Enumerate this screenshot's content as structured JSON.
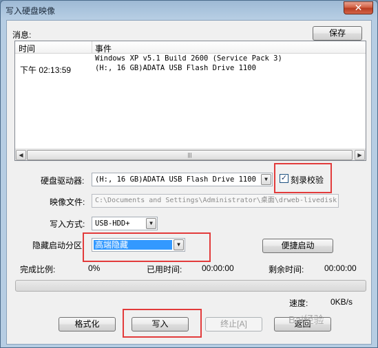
{
  "window": {
    "title": "写入硬盘映像",
    "close_glyph": "✕"
  },
  "messages": {
    "label": "消息:",
    "save_button": "保存",
    "columns": [
      "时间",
      "事件"
    ],
    "rows": [
      {
        "time": "",
        "event": "Windows XP v5.1 Build 2600 (Service Pack 3)"
      },
      {
        "time": "下午 02:13:59",
        "event": "(H:, 16 GB)ADATA   USB Flash Drive 1100"
      }
    ]
  },
  "drive": {
    "label": "硬盘驱动器:",
    "value": "(H:, 16 GB)ADATA   USB Flash Drive 1100",
    "verify_label": "刻录校验",
    "verify_checked": true
  },
  "image_file": {
    "label": "映像文件:",
    "value": "C:\\Documents and Settings\\Administrator\\桌面\\drweb-livedisk"
  },
  "write_mode": {
    "label": "写入方式:",
    "value": "USB-HDD+"
  },
  "hidden_partition": {
    "label": "隐藏启动分区",
    "value": "高端隐藏",
    "quick_boot_button": "便捷启动"
  },
  "progress": {
    "ratio_label": "完成比例:",
    "ratio_value": "0%",
    "elapsed_label": "已用时间:",
    "elapsed_value": "00:00:00",
    "remaining_label": "剩余时间:",
    "remaining_value": "00:00:00",
    "percent": 0,
    "speed_label": "速度:",
    "speed_value": "0KB/s"
  },
  "buttons": {
    "format": "格式化",
    "write": "写入",
    "terminate": "终止[A]",
    "back": "返回"
  },
  "watermark": "Bai经验",
  "colors": {
    "highlight": "#3399ff",
    "annotation": "#e23a3a"
  },
  "icons": {
    "scroll_left": "◀",
    "scroll_right": "▶",
    "scroll_grip": "|||",
    "dropdown": "▼",
    "check": "✓"
  }
}
